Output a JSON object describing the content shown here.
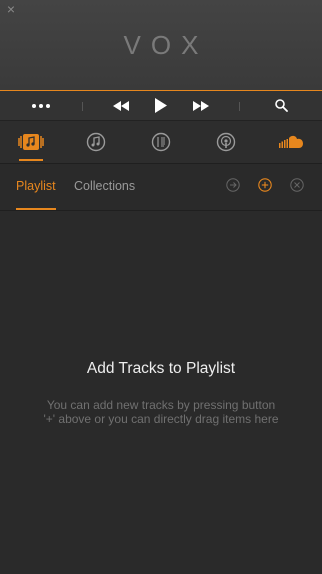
{
  "window": {
    "close_symbol": "×",
    "logo_text": "VOX"
  },
  "colors": {
    "accent": "#e7871e",
    "background": "#2a2a2a",
    "header": "#3e3e3e",
    "muted_text": "#707070",
    "primary_text": "#eeeeee",
    "icon_gray": "#9a9a9a"
  },
  "transport": {
    "icons": [
      "more-icon",
      "previous-icon",
      "play-icon",
      "next-icon",
      "search-icon"
    ]
  },
  "sources": {
    "items": [
      {
        "icon": "library-icon",
        "active": true
      },
      {
        "icon": "itunes-music-icon",
        "active": false
      },
      {
        "icon": "radio-icon",
        "active": false
      },
      {
        "icon": "podcast-icon",
        "active": false
      },
      {
        "icon": "soundcloud-icon",
        "active": false
      }
    ]
  },
  "tabs": {
    "playlist_label": "Playlist",
    "collections_label": "Collections",
    "icons": [
      "forward-circle-icon",
      "add-circle-icon",
      "remove-circle-icon"
    ]
  },
  "empty_state": {
    "title": "Add Tracks to Playlist",
    "description": "You can add new tracks by pressing button\n'+' above or you can directly drag items here"
  }
}
